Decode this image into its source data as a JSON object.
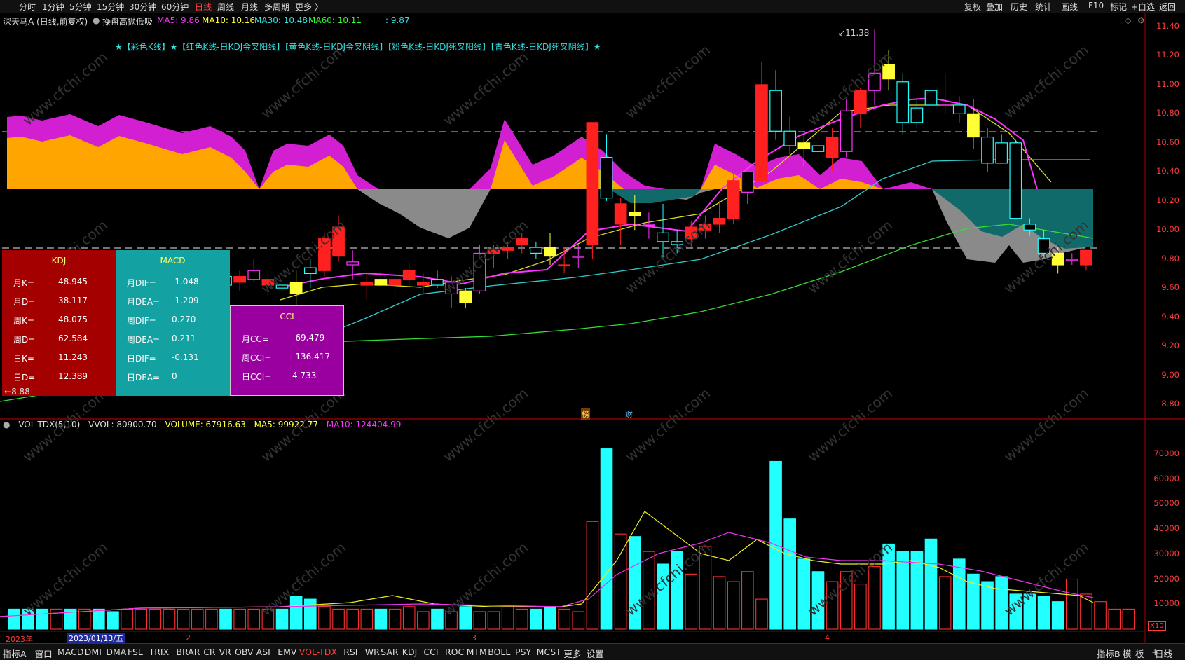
{
  "topbar": {
    "left": [
      "分时",
      "1分钟",
      "5分钟",
      "15分钟",
      "30分钟",
      "60分钟",
      "日线",
      "周线",
      "月线",
      "多周期",
      "更多 〉"
    ],
    "active": "日线",
    "right": [
      "复权",
      "叠加",
      "历史",
      "统计",
      "画线",
      "F10",
      "标记",
      "+自选",
      "返回"
    ]
  },
  "info": {
    "stock": "深天马A (日线,前复权)",
    "indicator": "操盘高抛低吸",
    "ma5": "MA5: 9.86",
    "ma10": "MA10: 10.16",
    "ma30": "MA30: 10.48",
    "ma60": "MA60: 10.11",
    "extra": ": 9.87"
  },
  "legend": "★【彩色K线】★【红色K线-日KDJ金叉阳线】【黄色K线-日KDJ金叉阴线】【粉色K线-日KDJ死叉阳线】【青色K线-日KDJ死叉阴线】★",
  "price_axis": [
    "11.40",
    "11.20",
    "11.00",
    "10.80",
    "10.60",
    "10.40",
    "10.20",
    "10.00",
    "9.80",
    "9.60",
    "9.40",
    "9.20",
    "9.00",
    "8.80"
  ],
  "vol_axis": [
    "70000",
    "60000",
    "50000",
    "40000",
    "30000",
    "20000",
    "10000"
  ],
  "vol_unit": "X10",
  "high_label": "11.38",
  "low_label": "8.88",
  "marks": {
    "m1": "榜",
    "m2": "财"
  },
  "kdj": {
    "title": "KDJ",
    "rows": [
      [
        "月K=",
        "48.945"
      ],
      [
        "月D=",
        "38.117"
      ],
      [
        "周K=",
        "48.075"
      ],
      [
        "周D=",
        "62.584"
      ],
      [
        "日K=",
        "11.243"
      ],
      [
        "日D=",
        "12.389"
      ]
    ]
  },
  "macd": {
    "title": "MACD",
    "rows": [
      [
        "月DIF=",
        "-1.048"
      ],
      [
        "月DEA=",
        "-1.209"
      ],
      [
        "周DIF=",
        "0.270"
      ],
      [
        "周DEA=",
        "0.211"
      ],
      [
        "日DIF=",
        "-0.131"
      ],
      [
        "日DEA=",
        "0"
      ]
    ]
  },
  "cci": {
    "title": "CCI",
    "rows": [
      [
        "月CC=",
        "-69.479"
      ],
      [
        "周CCI=",
        "-136.417"
      ],
      [
        "日CCI=",
        "4.733"
      ]
    ]
  },
  "vol_info": {
    "name": "VOL-TDX(5,10)",
    "vvol": "VVOL: 80900.70",
    "volume": "VOLUME: 67916.63",
    "ma5": "MA5: 99922.77",
    "ma10": "MA10: 124404.99"
  },
  "date_axis": {
    "year": "2023年",
    "date": "2023/01/13/五",
    "m2": "2",
    "m3": "3",
    "m4": "4"
  },
  "bottombar": {
    "items": [
      "指标A",
      "窗口",
      "MACD",
      "DMI",
      "DMA",
      "FSL",
      "TRIX",
      "BRAR",
      "CR",
      "VR",
      "OBV",
      "ASI",
      "EMV",
      "VOL-TDX",
      "RSI",
      "WR",
      "SAR",
      "KDJ",
      "CCI",
      "ROC",
      "MTM",
      "BOLL",
      "PSY",
      "MCST",
      "更多",
      "设置"
    ],
    "active": "VOL-TDX",
    "right": [
      "指标B",
      "模",
      "板",
      "+",
      "-",
      "日线"
    ]
  },
  "watermark": "www.cfchi.com",
  "colors": {
    "up": "#ff2020",
    "down": "#22ffff",
    "yellow": "#ffff33",
    "pink": "#ff33ff",
    "orange": "#ffa500",
    "teal": "#116a6a",
    "gray": "#888888",
    "kdj_bg": "#a50000",
    "macd_bg": "#13a1a1",
    "cci_bg": "#9a00a0"
  },
  "chart_data": {
    "type": "candlestick",
    "ylim": [
      8.8,
      11.4
    ],
    "candles": [
      [
        9.46,
        9.5,
        9.4,
        9.44
      ],
      [
        9.52,
        9.55,
        9.46,
        9.48
      ],
      [
        9.55,
        9.6,
        9.48,
        9.5
      ],
      [
        9.52,
        9.58,
        9.48,
        9.56
      ],
      [
        9.62,
        9.66,
        9.56,
        9.58
      ],
      [
        9.6,
        9.66,
        9.55,
        9.62
      ],
      [
        9.62,
        9.66,
        9.56,
        9.58
      ],
      [
        9.6,
        9.64,
        9.52,
        9.58
      ],
      [
        9.58,
        9.64,
        9.52,
        9.6
      ],
      [
        9.66,
        9.78,
        9.62,
        9.74
      ],
      [
        9.68,
        9.76,
        9.6,
        9.72
      ],
      [
        9.66,
        9.72,
        9.58,
        9.7
      ],
      [
        9.72,
        9.8,
        9.66,
        9.76
      ],
      [
        9.64,
        9.76,
        9.58,
        9.74
      ],
      [
        9.7,
        9.78,
        9.62,
        9.72
      ],
      [
        9.68,
        9.76,
        9.58,
        9.62
      ],
      [
        9.64,
        9.72,
        9.58,
        9.68
      ],
      [
        9.66,
        9.8,
        9.64,
        9.72
      ],
      [
        9.62,
        9.7,
        9.54,
        9.66
      ],
      [
        9.62,
        9.7,
        9.54,
        9.6
      ],
      [
        9.64,
        9.72,
        9.46,
        9.56
      ],
      [
        9.74,
        9.8,
        9.6,
        9.7
      ],
      [
        9.72,
        9.98,
        9.68,
        9.94
      ],
      [
        9.82,
        10.1,
        9.78,
        10.02
      ],
      [
        9.76,
        9.86,
        9.66,
        9.78
      ],
      [
        9.62,
        9.7,
        9.52,
        9.64
      ],
      [
        9.66,
        9.7,
        9.6,
        9.62
      ],
      [
        9.62,
        9.7,
        9.56,
        9.66
      ],
      [
        9.66,
        9.78,
        9.62,
        9.72
      ],
      [
        9.62,
        9.7,
        9.56,
        9.64
      ],
      [
        9.66,
        9.72,
        9.6,
        9.62
      ],
      [
        9.56,
        9.68,
        9.46,
        9.64
      ],
      [
        9.58,
        9.6,
        9.46,
        9.5
      ],
      [
        9.58,
        9.9,
        9.56,
        9.84
      ],
      [
        9.84,
        9.9,
        9.74,
        9.86
      ],
      [
        9.86,
        9.92,
        9.8,
        9.88
      ],
      [
        9.9,
        9.98,
        9.84,
        9.94
      ],
      [
        9.88,
        9.92,
        9.8,
        9.84
      ],
      [
        9.88,
        9.98,
        9.76,
        9.82
      ],
      [
        9.76,
        9.88,
        9.7,
        9.76
      ],
      [
        9.82,
        9.9,
        9.74,
        9.82
      ],
      [
        9.9,
        10.74,
        9.8,
        10.74
      ],
      [
        10.5,
        10.66,
        10.2,
        10.22
      ],
      [
        10.04,
        10.22,
        9.9,
        10.18
      ],
      [
        10.12,
        10.24,
        10.0,
        10.1
      ],
      [
        10.04,
        10.12,
        9.94,
        10.04
      ],
      [
        9.98,
        10.18,
        9.8,
        9.92
      ],
      [
        9.92,
        10.0,
        9.84,
        9.9
      ],
      [
        9.94,
        10.06,
        9.88,
        10.02
      ],
      [
        10.0,
        10.1,
        9.94,
        10.04
      ],
      [
        10.04,
        10.2,
        9.98,
        10.08
      ],
      [
        10.08,
        10.38,
        10.04,
        10.34
      ],
      [
        10.26,
        10.4,
        10.18,
        10.4
      ],
      [
        10.34,
        11.16,
        10.3,
        11.0
      ],
      [
        10.96,
        11.1,
        10.62,
        10.68
      ],
      [
        10.68,
        10.78,
        10.52,
        10.58
      ],
      [
        10.6,
        10.66,
        10.44,
        10.56
      ],
      [
        10.58,
        10.68,
        10.46,
        10.54
      ],
      [
        10.5,
        10.7,
        10.4,
        10.64
      ],
      [
        10.54,
        10.9,
        10.5,
        10.82
      ],
      [
        10.8,
        10.98,
        10.7,
        10.96
      ],
      [
        10.96,
        11.38,
        10.86,
        11.08
      ],
      [
        11.14,
        11.24,
        10.96,
        11.04
      ],
      [
        11.02,
        11.08,
        10.66,
        10.74
      ],
      [
        10.84,
        10.9,
        10.7,
        10.74
      ],
      [
        10.96,
        11.06,
        10.78,
        10.86
      ],
      [
        10.86,
        11.08,
        10.8,
        10.86
      ],
      [
        10.86,
        10.92,
        10.74,
        10.8
      ],
      [
        10.8,
        10.9,
        10.56,
        10.64
      ],
      [
        10.64,
        10.7,
        10.4,
        10.46
      ],
      [
        10.6,
        10.66,
        10.46,
        10.46
      ],
      [
        10.6,
        10.62,
        10.08,
        10.08
      ],
      [
        10.04,
        10.08,
        9.96,
        10.0
      ],
      [
        9.94,
        10.0,
        9.82,
        9.84
      ],
      [
        9.84,
        9.88,
        9.7,
        9.76
      ],
      [
        9.8,
        9.84,
        9.76,
        9.8
      ],
      [
        9.76,
        9.86,
        9.72,
        9.86
      ]
    ],
    "volume": [
      8,
      8,
      8,
      8,
      8,
      8,
      8,
      7,
      8,
      8,
      8,
      8,
      8,
      8,
      8,
      8,
      8,
      8,
      8,
      8,
      13,
      12,
      9,
      8,
      8,
      8,
      8,
      8,
      9,
      7,
      8,
      7,
      9,
      7,
      7,
      9,
      8,
      8,
      9,
      8,
      7,
      43,
      72,
      38,
      37,
      31,
      26,
      31,
      22,
      33,
      21,
      19,
      23,
      12,
      67,
      44,
      28,
      23,
      19,
      23,
      18,
      25,
      34,
      31,
      31,
      36,
      21,
      28,
      22,
      19,
      21,
      14,
      14,
      13,
      11,
      20,
      14,
      11,
      8,
      8
    ],
    "vol_ylim": [
      0,
      80000
    ]
  }
}
